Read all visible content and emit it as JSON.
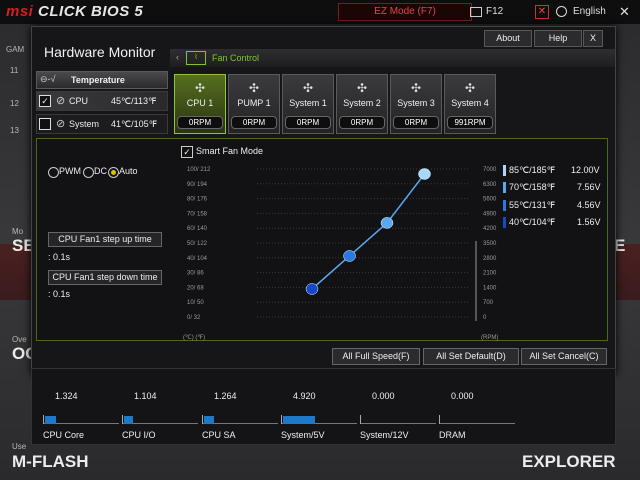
{
  "header": {
    "logo_brand": "msi",
    "logo_product": "CLICK BIOS 5",
    "ez_mode": "EZ Mode (F7)",
    "f12": "F12",
    "language": "English",
    "close_symbol": "✕"
  },
  "background": {
    "numbers": [
      "11",
      "12",
      "13"
    ],
    "left_big_labels": [
      "Mo",
      "SE",
      "Ove",
      "OC",
      "Use",
      "M-FLASH"
    ],
    "right_big_labels": [
      "E",
      "EXPLORER"
    ],
    "gam": "GAM"
  },
  "window": {
    "title": "Hardware Monitor",
    "buttons": {
      "about": "About",
      "help": "Help",
      "close": "X"
    },
    "panel_label": "Fan Control"
  },
  "temperature": {
    "header": "Temperature",
    "rows": [
      {
        "name": "CPU",
        "value": "45℃/113℉",
        "checked": true
      },
      {
        "name": "System",
        "value": "41℃/105℉",
        "checked": false
      }
    ]
  },
  "fans": [
    {
      "name": "CPU 1",
      "rpm": "0RPM",
      "active": true
    },
    {
      "name": "PUMP 1",
      "rpm": "0RPM",
      "active": false
    },
    {
      "name": "System 1",
      "rpm": "0RPM",
      "active": false
    },
    {
      "name": "System 2",
      "rpm": "0RPM",
      "active": false
    },
    {
      "name": "System 3",
      "rpm": "0RPM",
      "active": false
    },
    {
      "name": "System 4",
      "rpm": "991RPM",
      "active": false
    }
  ],
  "modes": {
    "pwm": "PWM",
    "dc": "DC",
    "auto": "Auto",
    "selected": "auto"
  },
  "step": {
    "up_label": "CPU Fan1 step up time",
    "up_value": ": 0.1s",
    "down_label": "CPU Fan1 step down time",
    "down_value": ": 0.1s"
  },
  "smart_fan": {
    "label": "Smart Fan Mode",
    "checked": true
  },
  "chart_data": {
    "type": "line",
    "left_ticks": [
      "100/ 212",
      "90/ 194",
      "80/ 176",
      "70/ 158",
      "60/ 140",
      "50/ 122",
      "40/ 104",
      "30/  86",
      "20/  68",
      "10/  50",
      "0/  32"
    ],
    "right_ticks": [
      "7000",
      "6300",
      "5600",
      "4900",
      "4200",
      "3500",
      "2800",
      "2100",
      "1400",
      "700",
      "0"
    ],
    "x_unit": "(℃) (℉)",
    "y_unit": "(RPM)",
    "points": [
      {
        "temp_c": 40,
        "voltage": 1.56
      },
      {
        "temp_c": 55,
        "voltage": 4.56
      },
      {
        "temp_c": 70,
        "voltage": 7.56
      },
      {
        "temp_c": 85,
        "voltage": 12.0
      }
    ],
    "y_ticks_c": [
      100,
      90,
      80,
      70,
      60,
      50,
      40,
      30,
      20,
      10,
      0
    ]
  },
  "legend": [
    {
      "temp": "85℃/185℉",
      "volt": "12.00V",
      "color": "#a8d8ff"
    },
    {
      "temp": "70℃/158℉",
      "volt": "7.56V",
      "color": "#5aa8f0"
    },
    {
      "temp": "55℃/131℉",
      "volt": "4.56V",
      "color": "#2a78e0"
    },
    {
      "temp": "40℃/104℉",
      "volt": "1.56V",
      "color": "#1848c8"
    }
  ],
  "actions": {
    "full_speed": "All Full Speed(F)",
    "set_default": "All Set Default(D)",
    "set_cancel": "All Set Cancel(C)"
  },
  "voltages": [
    {
      "label": "CPU Core",
      "value": "1.324",
      "fill": 0.14
    },
    {
      "label": "CPU I/O",
      "value": "1.104",
      "fill": 0.12
    },
    {
      "label": "CPU SA",
      "value": "1.264",
      "fill": 0.13
    },
    {
      "label": "System/5V",
      "value": "4.920",
      "fill": 0.42
    },
    {
      "label": "System/12V",
      "value": "0.000",
      "fill": 0
    },
    {
      "label": "DRAM",
      "value": "0.000",
      "fill": 0
    }
  ]
}
